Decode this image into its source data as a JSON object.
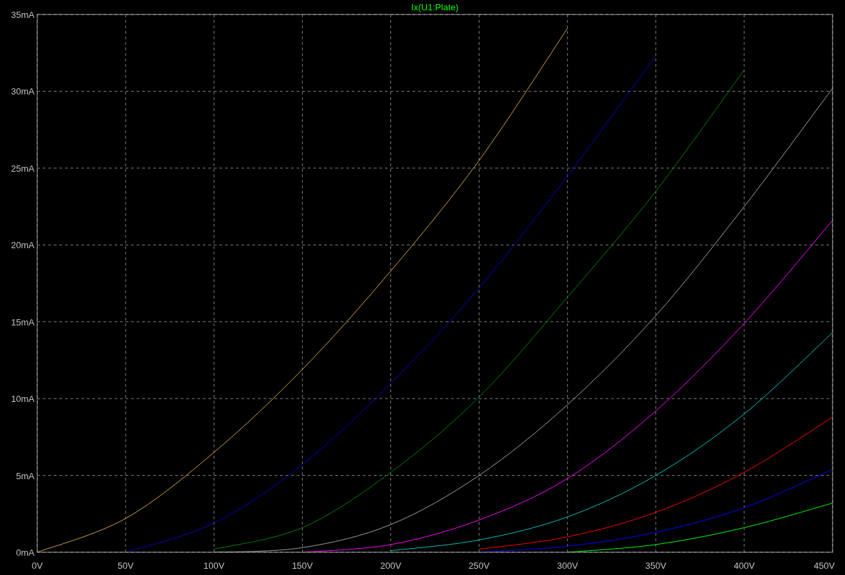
{
  "plot": {
    "chart_data": {
      "type": "line",
      "title": "Ix(U1:Plate)",
      "grid": true,
      "x": [
        0,
        50,
        100,
        150,
        200,
        250,
        300,
        350,
        400,
        450
      ],
      "xlim": [
        0,
        450
      ],
      "ylim": [
        0,
        35
      ],
      "xticks": [
        {
          "value": 0,
          "label": "0V"
        },
        {
          "value": 50,
          "label": "50V"
        },
        {
          "value": 100,
          "label": "100V"
        },
        {
          "value": 150,
          "label": "150V"
        },
        {
          "value": 200,
          "label": "200V"
        },
        {
          "value": 250,
          "label": "250V"
        },
        {
          "value": 300,
          "label": "300V"
        },
        {
          "value": 350,
          "label": "350V"
        },
        {
          "value": 400,
          "label": "400V"
        },
        {
          "value": 450,
          "label": "450V"
        }
      ],
      "yticks": [
        {
          "value": 0,
          "label": "0mA"
        },
        {
          "value": 5,
          "label": "5mA"
        },
        {
          "value": 10,
          "label": "10mA"
        },
        {
          "value": 15,
          "label": "15mA"
        },
        {
          "value": 20,
          "label": "20mA"
        },
        {
          "value": 25,
          "label": "25mA"
        },
        {
          "value": 30,
          "label": "30mA"
        },
        {
          "value": 35,
          "label": "35mA"
        }
      ],
      "series": [
        {
          "color": "#d0a040",
          "values": [
            0,
            2.2,
            6.5,
            11.9,
            18.3,
            25.5,
            34.1,
            null,
            null,
            null
          ]
        },
        {
          "color": "#0000c0",
          "values": [
            null,
            0,
            1.9,
            5.7,
            11,
            17.2,
            24.5,
            32.3,
            null,
            null
          ]
        },
        {
          "color": "#008000",
          "values": [
            null,
            null,
            0.2,
            1.6,
            5.2,
            10.1,
            16.6,
            23.5,
            31.4,
            null
          ]
        },
        {
          "color": "#a0a0a0",
          "values": [
            null,
            null,
            0,
            0.3,
            1.8,
            5,
            9.6,
            15.4,
            22.5,
            30.2
          ]
        },
        {
          "color": "#ff00ff",
          "values": [
            null,
            null,
            null,
            0,
            0.5,
            2.1,
            4.8,
            9.2,
            14.9,
            21.6
          ]
        },
        {
          "color": "#00c0c0",
          "values": [
            null,
            null,
            null,
            null,
            0.1,
            0.8,
            2.3,
            5,
            9,
            14.3
          ]
        },
        {
          "color": "#ff0000",
          "values": [
            null,
            null,
            null,
            null,
            null,
            0.2,
            1,
            2.6,
            5.2,
            8.8
          ]
        },
        {
          "color": "#0000ff",
          "values": [
            null,
            null,
            null,
            null,
            null,
            0,
            0.4,
            1.3,
            2.9,
            5.4
          ]
        },
        {
          "color": "#00ff00",
          "values": [
            null,
            null,
            null,
            null,
            null,
            null,
            0,
            0.5,
            1.6,
            3.2
          ]
        }
      ]
    }
  }
}
